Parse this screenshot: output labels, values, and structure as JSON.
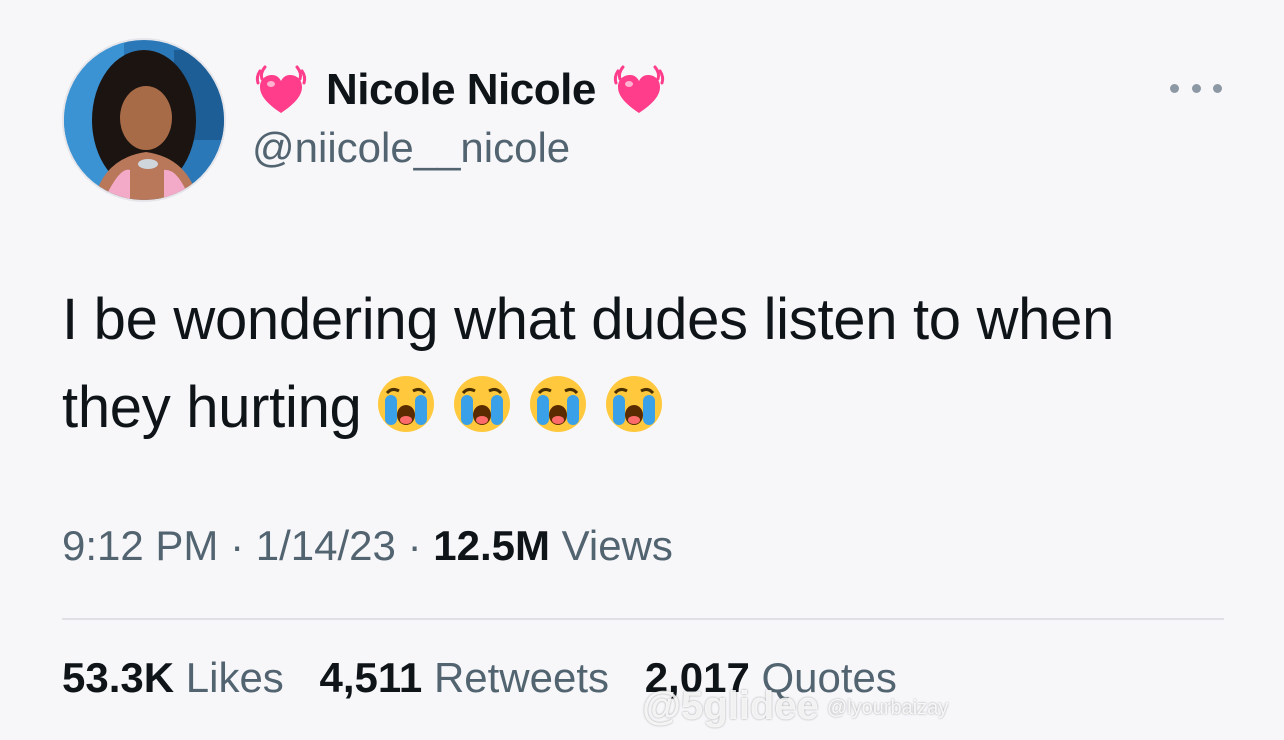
{
  "profile": {
    "display_name": "Nicole Nicole",
    "handle": "@niicole__nicole",
    "name_emoji": "beating-heart-icon"
  },
  "tweet": {
    "text": "I be wondering what dudes listen to when they hurting",
    "emoji": [
      "loudly-crying-face-icon",
      "loudly-crying-face-icon",
      "loudly-crying-face-icon",
      "loudly-crying-face-icon"
    ]
  },
  "meta": {
    "time": "9:12 PM",
    "date": "1/14/23",
    "separator": "·",
    "views_count": "12.5M",
    "views_label": "Views"
  },
  "stats": {
    "likes_count": "53.3K",
    "likes_label": "Likes",
    "retweets_count": "4,511",
    "retweets_label": "Retweets",
    "quotes_count": "2,017",
    "quotes_label": "Quotes"
  },
  "watermark": {
    "main": "@5glidee",
    "sub": "@lyourbaizay"
  },
  "colors": {
    "background": "#f7f7fa",
    "text_primary": "#0f1419",
    "text_secondary": "#536471",
    "heart": "#ff3d8b",
    "divider": "#dfe1e5"
  }
}
